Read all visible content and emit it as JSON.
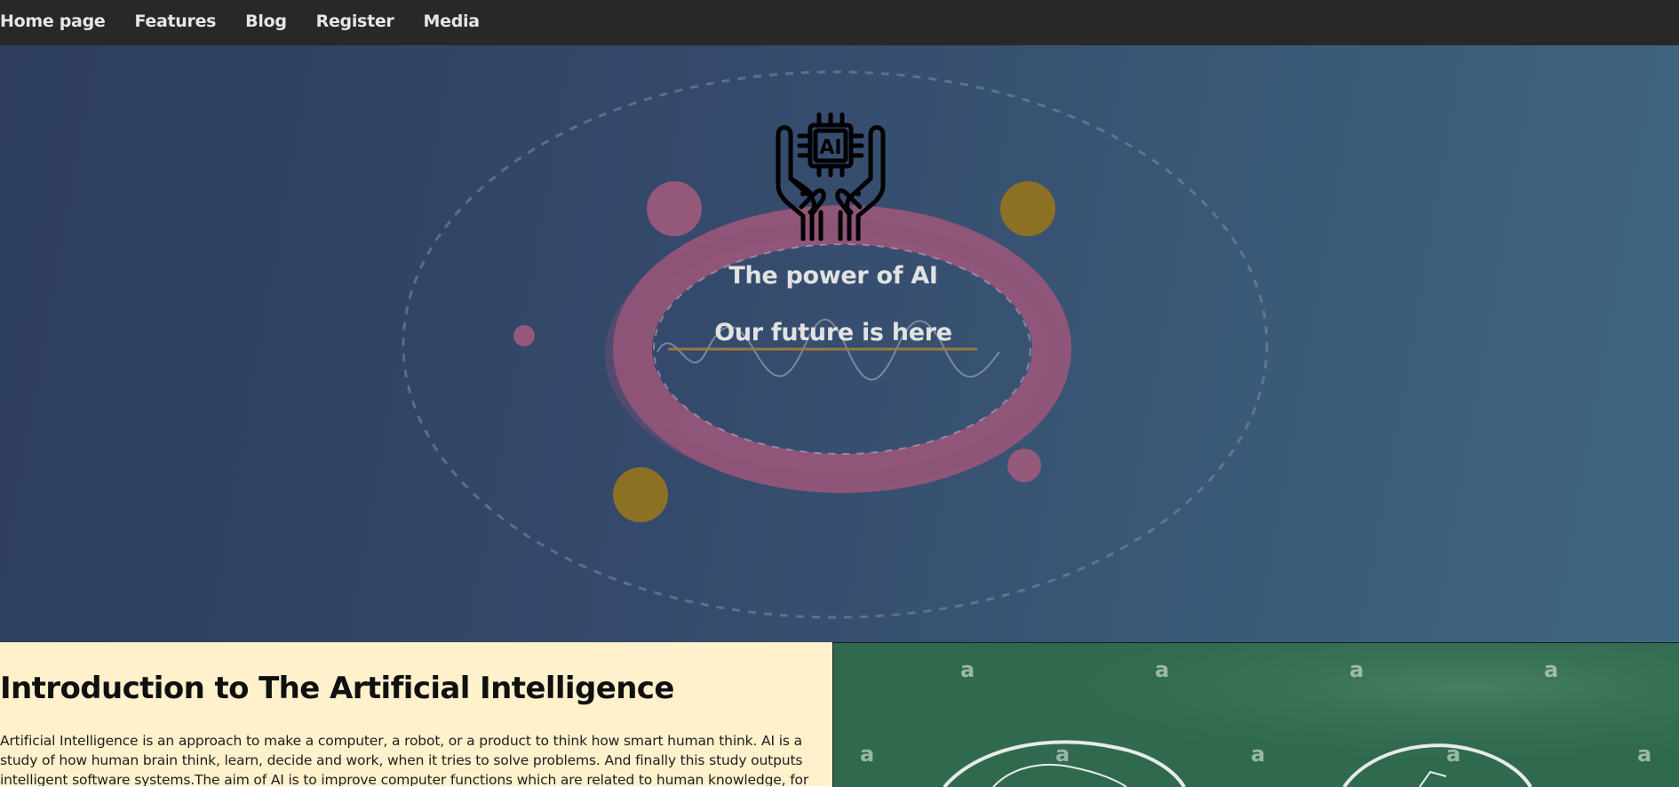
{
  "nav": {
    "items": [
      {
        "label": "Home page"
      },
      {
        "label": "Features"
      },
      {
        "label": "Blog"
      },
      {
        "label": "Register"
      },
      {
        "label": "Media"
      }
    ]
  },
  "hero": {
    "icon": "ai-chip-hands-icon",
    "icon_text": "AI",
    "title": "The power of AI",
    "subtitle": "Our future is here"
  },
  "intro": {
    "heading": "Introduction to The Artificial Intelligence",
    "paragraph": "Artificial Intelligence is an approach to make a computer, a robot, or a product to think how smart human think. AI is a study of how human brain think, learn, decide and work, when it tries to solve problems. And finally this study outputs intelligent software systems.The aim of AI is to improve computer functions which are related to human knowledge, for example, reasoning, learning, and problem-solving."
  },
  "board_image": {
    "watermark": "a"
  },
  "colors": {
    "nav_bg": "#282828",
    "hero_bg": "#34496b",
    "ring": "#b45a7a",
    "gold": "#9b7a1e",
    "intro_bg": "#fff1cc",
    "board_bg": "#2f6a4e"
  }
}
